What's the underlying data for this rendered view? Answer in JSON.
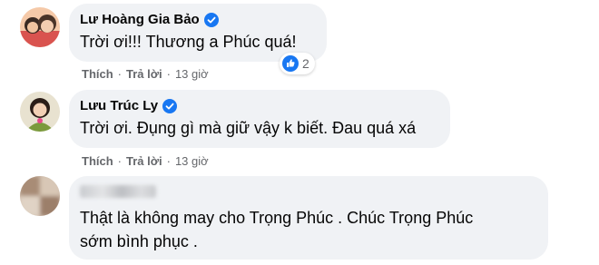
{
  "comments": [
    {
      "author": "Lư Hoàng Gia Bảo",
      "verified": true,
      "text": "Trời ơi!!! Thương a Phúc quá!",
      "like_label": "Thích",
      "reply_label": "Trả lời",
      "time": "13 giờ",
      "reaction_count": "2",
      "reaction_icon": "like-icon"
    },
    {
      "author": "Lưu Trúc Ly",
      "verified": true,
      "text": "Trời ơi. Đụng gì mà giữ vậy k biết. Đau quá xá",
      "like_label": "Thích",
      "reply_label": "Trả lời",
      "time": "13 giờ"
    },
    {
      "author_blurred": true,
      "text_line1": "Thật là không may cho Trọng Phúc . Chúc Trọng Phúc",
      "text_line2": "sớm bình phục ."
    }
  ],
  "colors": {
    "bubble": "#f0f2f5",
    "verified": "#1877f2",
    "muted": "#65676b"
  }
}
